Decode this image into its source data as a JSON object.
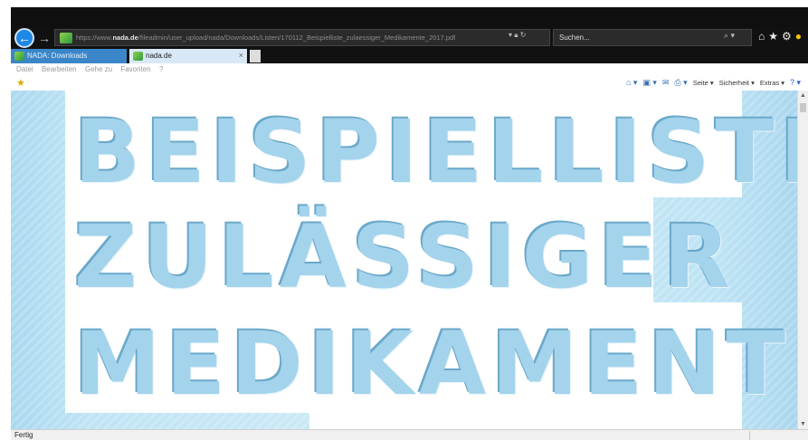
{
  "browser": {
    "url_prefix": "https://www.",
    "url_domain": "nada.de",
    "url_path": "/fileadmin/user_upload/nada/Downloads/Listen/170112_Beispielliste_zulaessiger_Medikamente_2017.pdf",
    "search_placeholder": "Suchen...",
    "tabs": [
      {
        "label": "NADA: Downloads"
      },
      {
        "label": "nada.de",
        "close": "×"
      }
    ],
    "menu": [
      "Datei",
      "Bearbeiten",
      "Gehe zu",
      "Favoriten",
      "?"
    ],
    "command_bar": {
      "page": "Seite ▾",
      "security": "Sicherheit ▾",
      "extras": "Extras ▾"
    },
    "status": "Fertig",
    "colors": {
      "accent": "#1e88e5",
      "active_tab": "#d8e8f7"
    }
  },
  "document": {
    "line1": "BEISPIELLISTE",
    "line2": "ZULÄSSIGER",
    "line3": "MEDIKAMENTE"
  }
}
